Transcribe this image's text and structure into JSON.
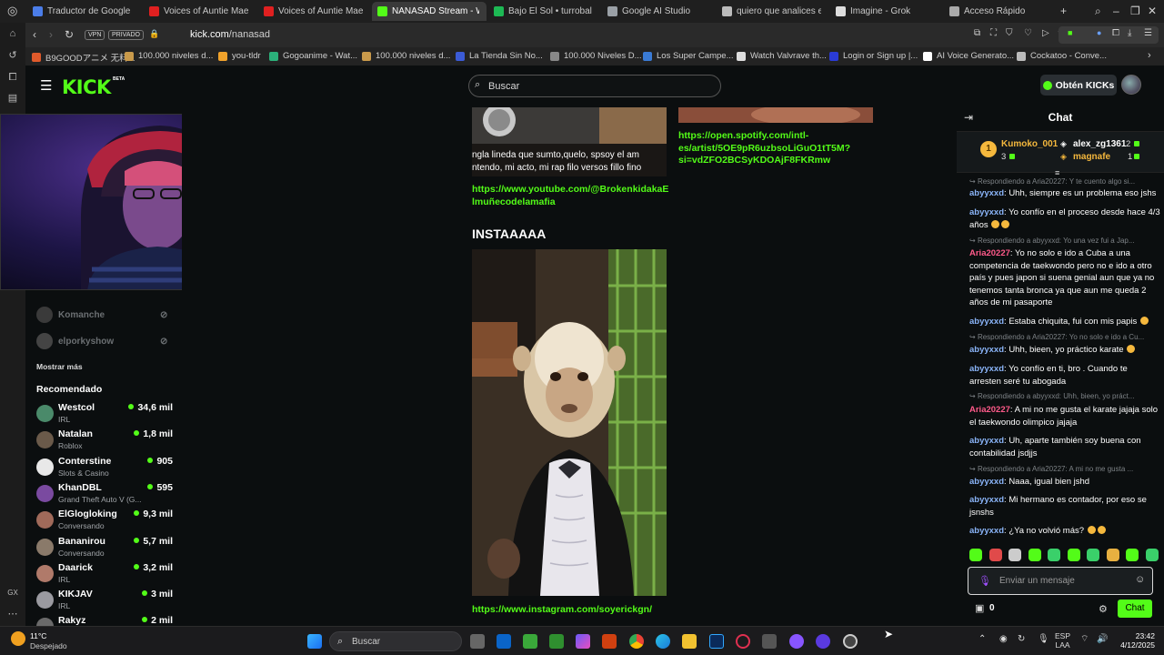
{
  "browser": {
    "tabs": [
      {
        "title": "Traductor de Google",
        "color": "#4b7de8"
      },
      {
        "title": "Voices of Auntie Mae - Y",
        "color": "#e02020"
      },
      {
        "title": "Voices of Auntie Mae - Y",
        "color": "#e02020"
      },
      {
        "title": "NANASAD Stream - Watc",
        "color": "#53fc18",
        "active": true
      },
      {
        "title": "Bajo El Sol • turrobal",
        "color": "#1db954"
      },
      {
        "title": "Google AI Studio",
        "color": "#9aa0a6"
      },
      {
        "title": "quiero que analices el c",
        "color": "#bbbbbb"
      },
      {
        "title": "Imagine - Grok",
        "color": "#dddddd"
      },
      {
        "title": "Acceso Rápido",
        "color": "#aaaaaa"
      }
    ],
    "vpn_label": "VPN",
    "private_label": "PRIVADO",
    "url_host": "kick.com",
    "url_path": "/nanasad",
    "bookmarks": [
      {
        "label": "B9GOODアニメ 无料...",
        "color": "#e05a2b"
      },
      {
        "label": "100.000 niveles d...",
        "color": "#c99a4b"
      },
      {
        "label": "you-tldr",
        "color": "#f0a22b"
      },
      {
        "label": "Gogoanime - Wat...",
        "color": "#2bb07a"
      },
      {
        "label": "100.000 niveles d...",
        "color": "#c99a4b"
      },
      {
        "label": "La Tienda Sin No...",
        "color": "#3b5bd6"
      },
      {
        "label": "100.000 Niveles D...",
        "color": "#888888"
      },
      {
        "label": "Los Super Campe...",
        "color": "#3a7bd5"
      },
      {
        "label": "Watch Valvrave th...",
        "color": "#dddddd"
      },
      {
        "label": "Login or Sign up |...",
        "color": "#2a3bd6"
      },
      {
        "label": "AI Voice Generato...",
        "color": "#ffffff"
      },
      {
        "label": "Cockatoo - Conve...",
        "color": "#bbbbbb"
      }
    ]
  },
  "kick": {
    "logo": "KICK",
    "beta": "BETA",
    "search_placeholder": "Buscar",
    "get_kicks": "Obtén KICKs"
  },
  "sidebar": {
    "followed": [
      {
        "name": "Komanche"
      },
      {
        "name": "elporkyshow"
      }
    ],
    "show_more": "Mostrar más",
    "recommended_title": "Recomendado",
    "recommended": [
      {
        "name": "Westcol",
        "category": "IRL",
        "viewers": "34,6 mil",
        "color": "#4a8a6a"
      },
      {
        "name": "Natalan",
        "category": "Roblox",
        "viewers": "1,8 mil",
        "color": "#6a5a4a"
      },
      {
        "name": "Conterstine",
        "category": "Slots & Casino",
        "viewers": "905",
        "color": "#e8e8e8"
      },
      {
        "name": "KhanDBL",
        "category": "Grand Theft Auto V (G...",
        "viewers": "595",
        "color": "#7a4aa0"
      },
      {
        "name": "ElGlogloking",
        "category": "Conversando",
        "viewers": "9,3 mil",
        "color": "#a06a5a"
      },
      {
        "name": "Bananirou",
        "category": "Conversando",
        "viewers": "5,7 mil",
        "color": "#8a7a6a"
      },
      {
        "name": "Daarick",
        "category": "IRL",
        "viewers": "3,2 mil",
        "color": "#b07a6a"
      },
      {
        "name": "KIKJAV",
        "category": "IRL",
        "viewers": "3 mil",
        "color": "#9a9aa0"
      },
      {
        "name": "Rakyz",
        "category": "",
        "viewers": "2 mil",
        "color": "#6a6a6a"
      }
    ],
    "player_watermark": "logi"
  },
  "content": {
    "image_caption_line1": "ngla lineda que sumto,quelo, spsoy el am",
    "image_caption_line2": "ntendo, mi acto, mi rap filo versos fillo fino",
    "youtube_link": "https://www.youtube.com/@BrokenkidakaE lmuñecodelamafia",
    "spotify_link": "https://open.spotify.com/intl- es/artist/5OE9pR6uzbsoLiGuO1tT5M? si=vdZFO2BCSyKDOAjF8FKRmw",
    "insta_heading": "INSTAAAAA",
    "instagram_link": "https://www.instagram.com/soyerickgn/"
  },
  "chat": {
    "title": "Chat",
    "pinned": [
      {
        "rank": "1",
        "name": "Kumoko_001",
        "count": "3",
        "color": "#f5b83d"
      },
      {
        "name": "alex_zg1361",
        "count": "2",
        "color": "#ffffff"
      },
      {
        "name": "magnafe",
        "count": "1",
        "color": "#f5b83d"
      }
    ],
    "messages": [
      {
        "reply": "Respondiendo a Aria20227: Y te cuento algo si...",
        "user": "abyyxxd",
        "user_color": "#8ab4f8",
        "text": "Uhh, siempre es un problema eso jshs"
      },
      {
        "user": "abyyxxd",
        "user_color": "#8ab4f8",
        "text": "Yo confío en el proceso desde hace 4/3 años"
      },
      {
        "reply": "Respondiendo a abyyxxd: Yo una vez fui a Jap...",
        "user": "Aria20227",
        "user_color": "#ff5a8a",
        "text": "Yo no solo e ido a Cuba a una competencia de taekwondo pero no e ido a otro país y pues japon si suena genial aun que ya no tenemos tanta bronca ya que aun me queda 2 años de mi pasaporte"
      },
      {
        "user": "abyyxxd",
        "user_color": "#8ab4f8",
        "text": "Estaba chiquita, fui con mis papis"
      },
      {
        "reply": "Respondiendo a Aria20227: Yo no solo e ido a Cu...",
        "user": "abyyxxd",
        "user_color": "#8ab4f8",
        "text": "Uhh, bieen, yo práctico karate"
      },
      {
        "user": "abyyxxd",
        "user_color": "#8ab4f8",
        "text": "Yo confío en ti, bro . Cuando te arresten seré tu abogada"
      },
      {
        "reply": "Respondiendo a abyyxxd: Uhh, bieen, yo práct...",
        "user": "Aria20227",
        "user_color": "#ff5a8a",
        "text": "A mi no me gusta el karate jajaja solo el taekwondo olimpico jajaja"
      },
      {
        "user": "abyyxxd",
        "user_color": "#8ab4f8",
        "text": "Uh, aparte también soy buena con contabilidad jsdjjs"
      },
      {
        "reply": "Respondiendo a Aria20227: A mi no me gusta ...",
        "user": "abyyxxd",
        "user_color": "#8ab4f8",
        "text": "Naaa, igual bien jshd"
      },
      {
        "user": "abyyxxd",
        "user_color": "#8ab4f8",
        "text": "Mi hermano es contador, por eso se jsnshs"
      },
      {
        "user": "abyyxxd",
        "user_color": "#8ab4f8",
        "text": "¿Ya no volvió más?"
      }
    ],
    "input_placeholder": "Enviar un mensaje",
    "kicks_count": "0",
    "send_label": "Chat"
  },
  "taskbar": {
    "weather_temp": "11°C",
    "weather_desc": "Despejado",
    "search_placeholder": "Buscar",
    "lang_line1": "ESP",
    "lang_line2": "LAA",
    "time": "23:42",
    "date": "4/12/2025"
  }
}
